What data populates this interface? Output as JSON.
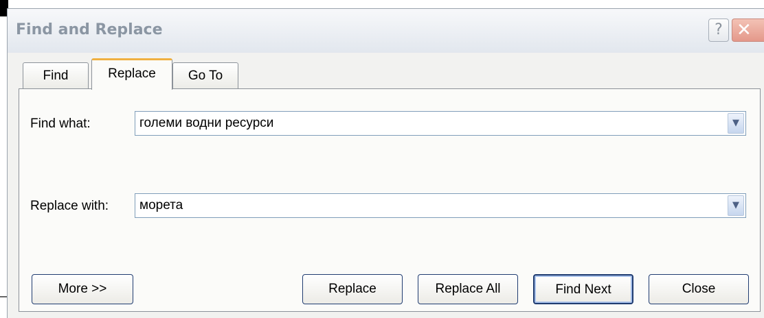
{
  "window": {
    "title": "Find and Replace"
  },
  "titlebar": {
    "help_label": "?",
    "close_label": "✕"
  },
  "tabs": [
    {
      "label": "Find",
      "active": false
    },
    {
      "label": "Replace",
      "active": true
    },
    {
      "label": "Go To",
      "active": false
    }
  ],
  "find": {
    "label": "Find what:",
    "value": "големи водни ресурси"
  },
  "replace": {
    "label": "Replace with:",
    "value": "морета"
  },
  "buttons": {
    "more": "More >>",
    "replace": "Replace",
    "replace_all": "Replace All",
    "find_next": "Find Next",
    "close": "Close"
  },
  "icons": {
    "dropdown": "chevron-down-icon",
    "help": "help-icon",
    "close": "close-icon"
  }
}
